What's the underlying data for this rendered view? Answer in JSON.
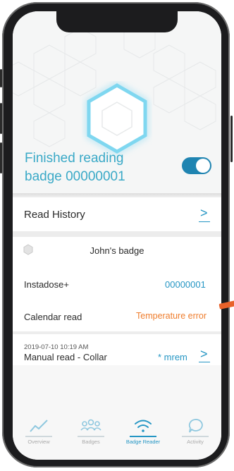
{
  "status": {
    "line1": "Finished reading",
    "line2": "badge 00000001",
    "toggle_on": true
  },
  "read_history": {
    "label": "Read History",
    "chevron": ">"
  },
  "badge": {
    "name": "John's badge"
  },
  "instadose": {
    "label": "Instadose+",
    "value": "00000001"
  },
  "calendar": {
    "label": "Calendar read",
    "value": "Temperature error"
  },
  "manual": {
    "timestamp": "2019-07-10 10:19 AM",
    "label": "Manual read - Collar",
    "value": "* mrem",
    "chevron": ">"
  },
  "nav": {
    "items": [
      {
        "label": "Overview",
        "icon": "chart-line-icon"
      },
      {
        "label": "Badges",
        "icon": "people-icon"
      },
      {
        "label": "Badge Reader",
        "icon": "wifi-icon"
      },
      {
        "label": "Activity",
        "icon": "chat-bubble-icon"
      }
    ],
    "active_index": 2
  },
  "colors": {
    "accent": "#2596c4",
    "status_text": "#3aa9c7",
    "error": "#ef7d2d",
    "toggle": "#1f84b1"
  }
}
